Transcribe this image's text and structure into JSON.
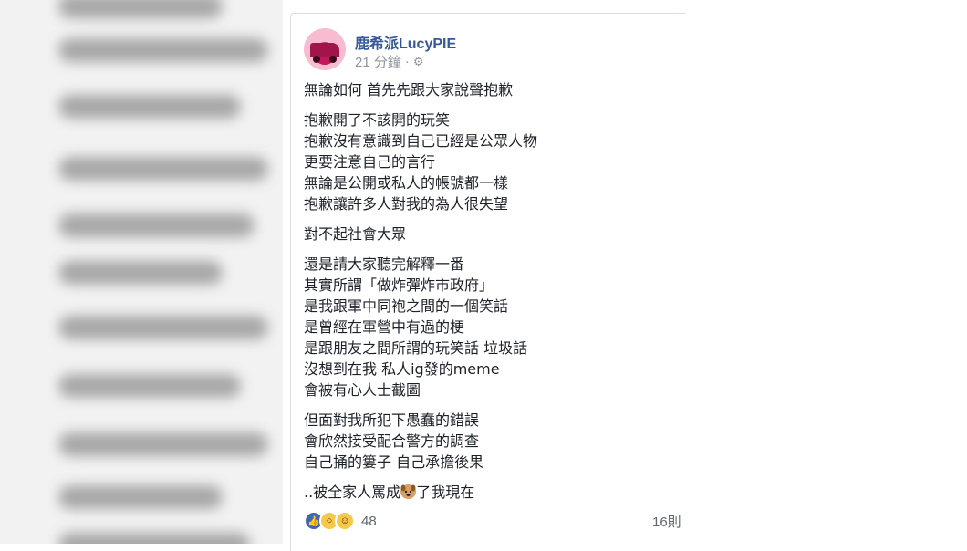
{
  "post": {
    "page_name": "鹿希派LucyPIE",
    "time": "21 分鐘",
    "separator": "·",
    "privacy_icon": "gear-icon",
    "paragraphs": [
      [
        "無論如何 首先先跟大家說聲抱歉"
      ],
      [
        "抱歉開了不該開的玩笑",
        "抱歉沒有意識到自己已經是公眾人物",
        "更要注意自己的言行",
        "無論是公開或私人的帳號都一樣",
        "抱歉讓許多人對我的為人很失望"
      ],
      [
        "對不起社會大眾"
      ],
      [
        "還是請大家聽完解釋一番",
        "其實所謂「做炸彈炸市政府」",
        "是我跟軍中同袍之間的一個笑話",
        "是曾經在軍營中有過的梗",
        "是跟朋友之間所謂的玩笑話 垃圾話",
        "沒想到在我 私人ig發的meme",
        "會被有心人士截圖"
      ],
      [
        "但面對我所犯下愚蠢的錯誤",
        "會欣然接受配合警方的調查",
        "自己捅的簍子 自己承擔後果"
      ]
    ],
    "last_line_before": "..被全家人罵成",
    "last_line_emoji": "dog-face-emoji",
    "last_line_after": "了我現在",
    "reactions": {
      "icons": [
        "like-icon",
        "wow-icon",
        "haha-icon"
      ],
      "count": "48"
    },
    "comments": "16則"
  },
  "colors": {
    "page_name": "#365899",
    "meta": "#90949c",
    "text": "#1d2129",
    "like": "#4267b2",
    "emoji_yellow": "#f7c94a"
  }
}
